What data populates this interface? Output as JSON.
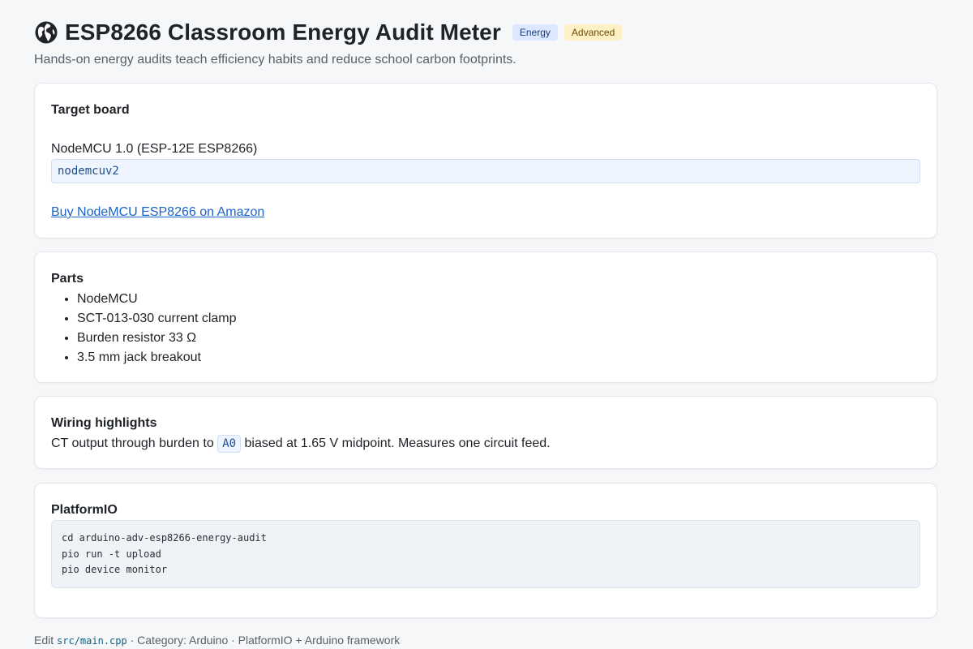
{
  "header": {
    "icon": "globe-icon",
    "title": "ESP8266 Classroom Energy Audit Meter",
    "badges": [
      "Energy",
      "Advanced"
    ],
    "subtitle": "Hands-on energy audits teach efficiency habits and reduce school carbon footprints."
  },
  "target_board": {
    "heading": "Target board",
    "name": "NodeMCU 1.0 (ESP-12E ESP8266)",
    "board_id": "nodemcuv2",
    "buy_link": "Buy NodeMCU ESP8266 on Amazon"
  },
  "parts": {
    "heading": "Parts",
    "items": [
      "NodeMCU",
      "SCT-013-030 current clamp",
      "Burden resistor 33 Ω",
      "3.5 mm jack breakout"
    ]
  },
  "wiring": {
    "heading": "Wiring highlights",
    "text_before": "CT output through burden to",
    "pin": "A0",
    "text_after": "biased at 1.65 V midpoint. Measures one circuit feed."
  },
  "platformio": {
    "heading": "PlatformIO",
    "commands": [
      "cd arduino-adv-esp8266-energy-audit",
      "pio run -t upload",
      "pio device monitor"
    ]
  },
  "footer": {
    "edit_prefix": "Edit",
    "file": "src/main.cpp",
    "rest": "· Category: Arduino · PlatformIO + Arduino framework"
  },
  "colors": {
    "energy_badge_bg": "#dbe8ff",
    "advanced_badge_bg": "#fff1c6",
    "link": "#1a63c9"
  }
}
